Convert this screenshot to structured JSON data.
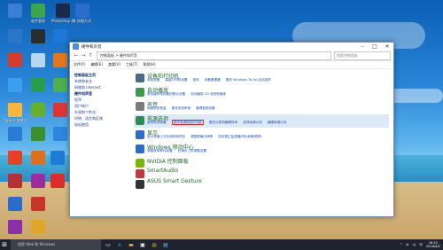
{
  "desktop": {
    "icons": [
      {
        "label": "",
        "color": "#3a7fd4"
      },
      {
        "label": "软件管家",
        "color": "#3ca64a"
      },
      {
        "label": "Photoshop 快捷方式",
        "color": "#1c2a4a"
      },
      {
        "label": "K 快捷方式",
        "color": "#2a6dcc"
      },
      {
        "label": "",
        "color": "#2b76c9"
      },
      {
        "label": "",
        "color": "#2c2c2c"
      },
      {
        "label": "",
        "color": "#1b78d6"
      },
      {
        "label": "",
        "color": "#d83a2a"
      },
      {
        "label": "",
        "color": "#b6d6f2"
      },
      {
        "label": "",
        "color": "#e4761b"
      },
      {
        "label": "",
        "color": "#3a9ff0"
      },
      {
        "label": "",
        "color": "#2a9d4a"
      },
      {
        "label": "",
        "color": "#4cb04c"
      },
      {
        "label": "Typora 快捷方式",
        "color": "#ffb638"
      },
      {
        "label": "",
        "color": "#68b02a"
      },
      {
        "label": "",
        "color": "#e03434"
      },
      {
        "label": "",
        "color": "#2b7bd6"
      },
      {
        "label": "",
        "color": "#3d8f2a"
      },
      {
        "label": "",
        "color": "#e3441f"
      },
      {
        "label": "",
        "color": "#e06f1c"
      },
      {
        "label": "",
        "color": "#1e7bd8"
      },
      {
        "label": "",
        "color": "#b53030"
      },
      {
        "label": "",
        "color": "#9a2ea0"
      },
      {
        "label": "",
        "color": "#2a6dcc"
      },
      {
        "label": "",
        "color": "#c9342a"
      },
      {
        "label": "",
        "color": "#8b2ea8"
      },
      {
        "label": "",
        "color": "#dfa62a"
      },
      {
        "label": "",
        "color": "#2e86de"
      },
      {
        "label": "",
        "color": "#dd2c2c"
      }
    ]
  },
  "window": {
    "title": "硬件和声音",
    "address": "控制面板 > 硬件和声音",
    "search_placeholder": "搜索控制面板",
    "menu": [
      "文件(F)",
      "编辑(E)",
      "查看(V)",
      "工具(T)",
      "帮助(H)"
    ],
    "side": {
      "header": "控制面板主页",
      "items": [
        "系统和安全",
        "网络和 Internet",
        "硬件和声音",
        "程序",
        "用户帐户",
        "外观和个性化",
        "时钟、语言和区域",
        "轻松使用"
      ]
    },
    "categories": [
      {
        "title": "设备和打印机",
        "color": "#4a6a8a",
        "links": [
          "添加设备",
          "高级打印机设置",
          "鼠标",
          "设备管理器",
          "更改 Windows To Go 启动选项"
        ],
        "boxed": -1
      },
      {
        "title": "自动播放",
        "color": "#3a9a4a",
        "links": [
          "更改媒体或设备的默认设置",
          "自动播放 CD 或其他媒体"
        ],
        "boxed": -1
      },
      {
        "title": "声音",
        "color": "#7a7a7a",
        "links": [
          "调整系统音量",
          "更改系统声音",
          "管理音频设备"
        ],
        "boxed": -1
      },
      {
        "title": "电源选项",
        "color": "#2e8b57",
        "links": [
          "更改电池设置",
          "更改电源按钮的功能",
          "更改计算机睡眠时间",
          "选择电源计划",
          "编辑电源计划"
        ],
        "boxed": 1
      },
      {
        "title": "显示",
        "color": "#2a6dcc",
        "links": [
          "放大或缩小文本和其他项目",
          "调整屏幕分辨率",
          "如何更正监视器闪烁(刷新频率)"
        ],
        "boxed": -1
      },
      {
        "title": "Windows 移动中心",
        "color": "#2a6dcc",
        "links": [
          "调整常用移动设置",
          "在演示之前调整设置"
        ],
        "boxed": -1
      },
      {
        "title": "NVIDIA 控制面板",
        "color": "#76b900",
        "links": [],
        "boxed": -1
      },
      {
        "title": "SmartAudio",
        "color": "#c23a3a",
        "links": [],
        "boxed": -1
      },
      {
        "title": "ASUS Smart Gesture",
        "color": "#333333",
        "links": [],
        "boxed": -1
      }
    ]
  },
  "taskbar": {
    "search_text": "搜索 Web 和 Windows",
    "time": "16:52",
    "date": "2016/6/2",
    "lang": "中"
  }
}
